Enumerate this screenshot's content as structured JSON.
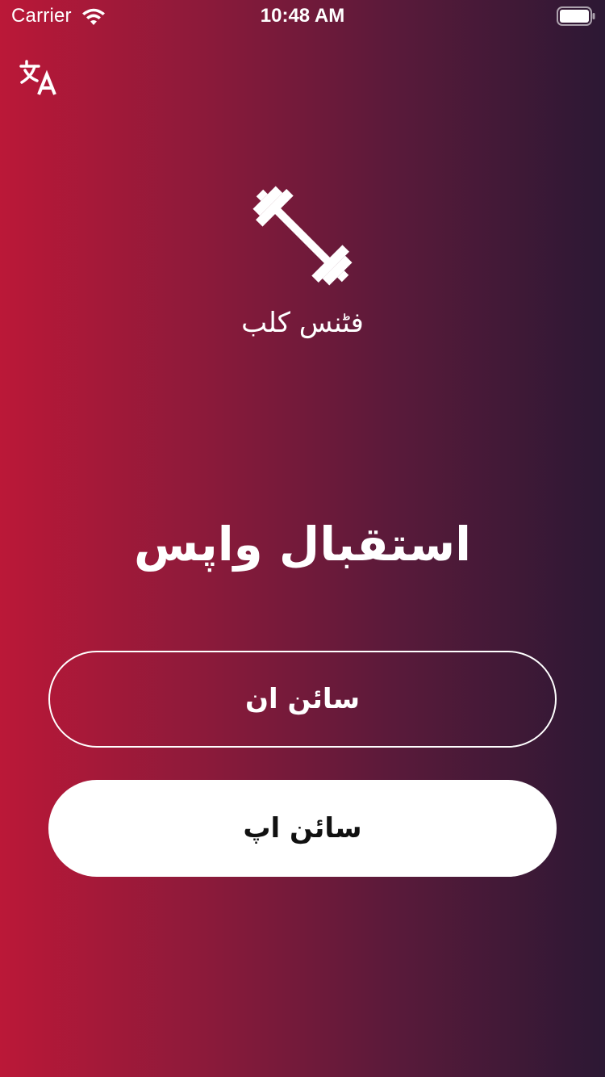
{
  "status_bar": {
    "carrier": "Carrier",
    "time": "10:48 AM",
    "icons": [
      "wifi-icon",
      "battery-icon"
    ]
  },
  "translate_button": {
    "icon": "translate-icon"
  },
  "logo": {
    "icon": "dumbbell-icon",
    "app_name": "فٹنس کلب"
  },
  "welcome": {
    "title": "استقبال واپس"
  },
  "buttons": {
    "sign_in": "سائن ان",
    "sign_up": "سائن اپ"
  },
  "colors": {
    "gradient_start": "#bb1838",
    "gradient_end": "#2c1834",
    "button_fill": "#ffffff",
    "button_text_dark": "#111111"
  }
}
